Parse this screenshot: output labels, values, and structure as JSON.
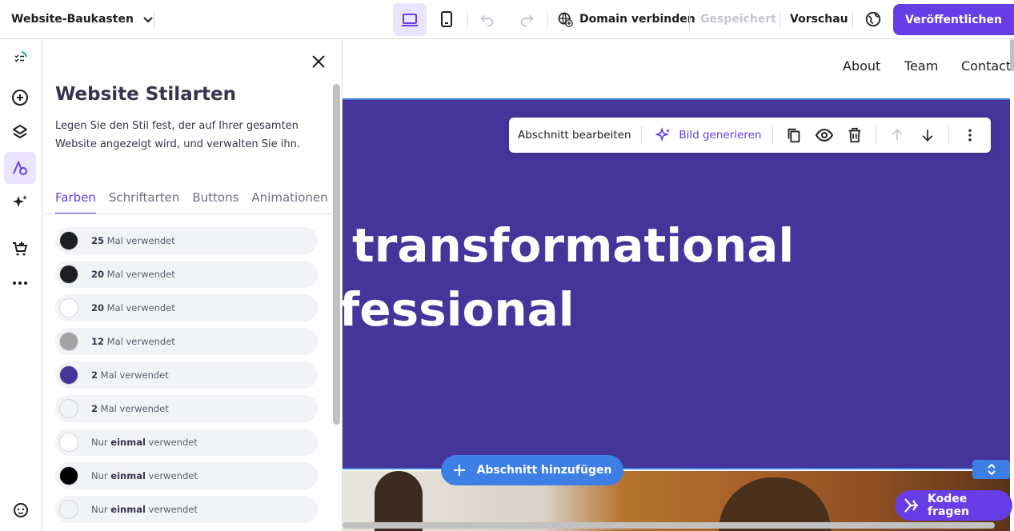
{
  "topbar": {
    "brand": "Website-Baukasten",
    "domain_label": "Domain verbinden",
    "saved_label": "Gespeichert",
    "preview_label": "Vorschau",
    "publish_label": "Veröffentlichen"
  },
  "panel": {
    "title": "Website Stilarten",
    "description": "Legen Sie den Stil fest, der auf Ihrer gesamten Website angezeigt wird, und verwalten Sie ihn.",
    "tabs": [
      {
        "label": "Farben"
      },
      {
        "label": "Schriftarten"
      },
      {
        "label": "Buttons"
      },
      {
        "label": "Animationen"
      }
    ],
    "colors": [
      {
        "count": "25",
        "suffix": " Mal verwendet",
        "color": "#1d1e20"
      },
      {
        "count": "20",
        "suffix": " Mal verwendet",
        "color": "#1d1e20"
      },
      {
        "count": "20",
        "suffix": " Mal verwendet",
        "color": "#ffffff"
      },
      {
        "count": "12",
        "suffix": " Mal verwendet",
        "color": "#a3a3a3"
      },
      {
        "count": "2",
        "suffix": " Mal verwendet",
        "color": "#45359a"
      },
      {
        "count": "2",
        "suffix": " Mal verwendet",
        "color": "#f2f3f6"
      },
      {
        "prefix": "Nur ",
        "count": "einmal",
        "suffix": " verwendet",
        "color": "#ffffff"
      },
      {
        "prefix": "Nur ",
        "count": "einmal",
        "suffix": " verwendet",
        "color": "#000000"
      },
      {
        "prefix": "Nur ",
        "count": "einmal",
        "suffix": " verwendet",
        "color": "#f2f3f6"
      }
    ]
  },
  "canvas": {
    "nav": [
      "About",
      "Team",
      "Contact"
    ],
    "hero_line1": "transformational",
    "hero_line2": "fessional",
    "hero_bg": "#45359a",
    "section_toolbar": {
      "edit_label": "Abschnitt bearbeiten",
      "generate_label": "Bild generieren"
    },
    "add_section_label": "Abschnitt hinzufügen",
    "kodee_label": "Kodee fragen"
  },
  "colors": {
    "accent": "#673de6",
    "blue": "#3e7fe6"
  }
}
